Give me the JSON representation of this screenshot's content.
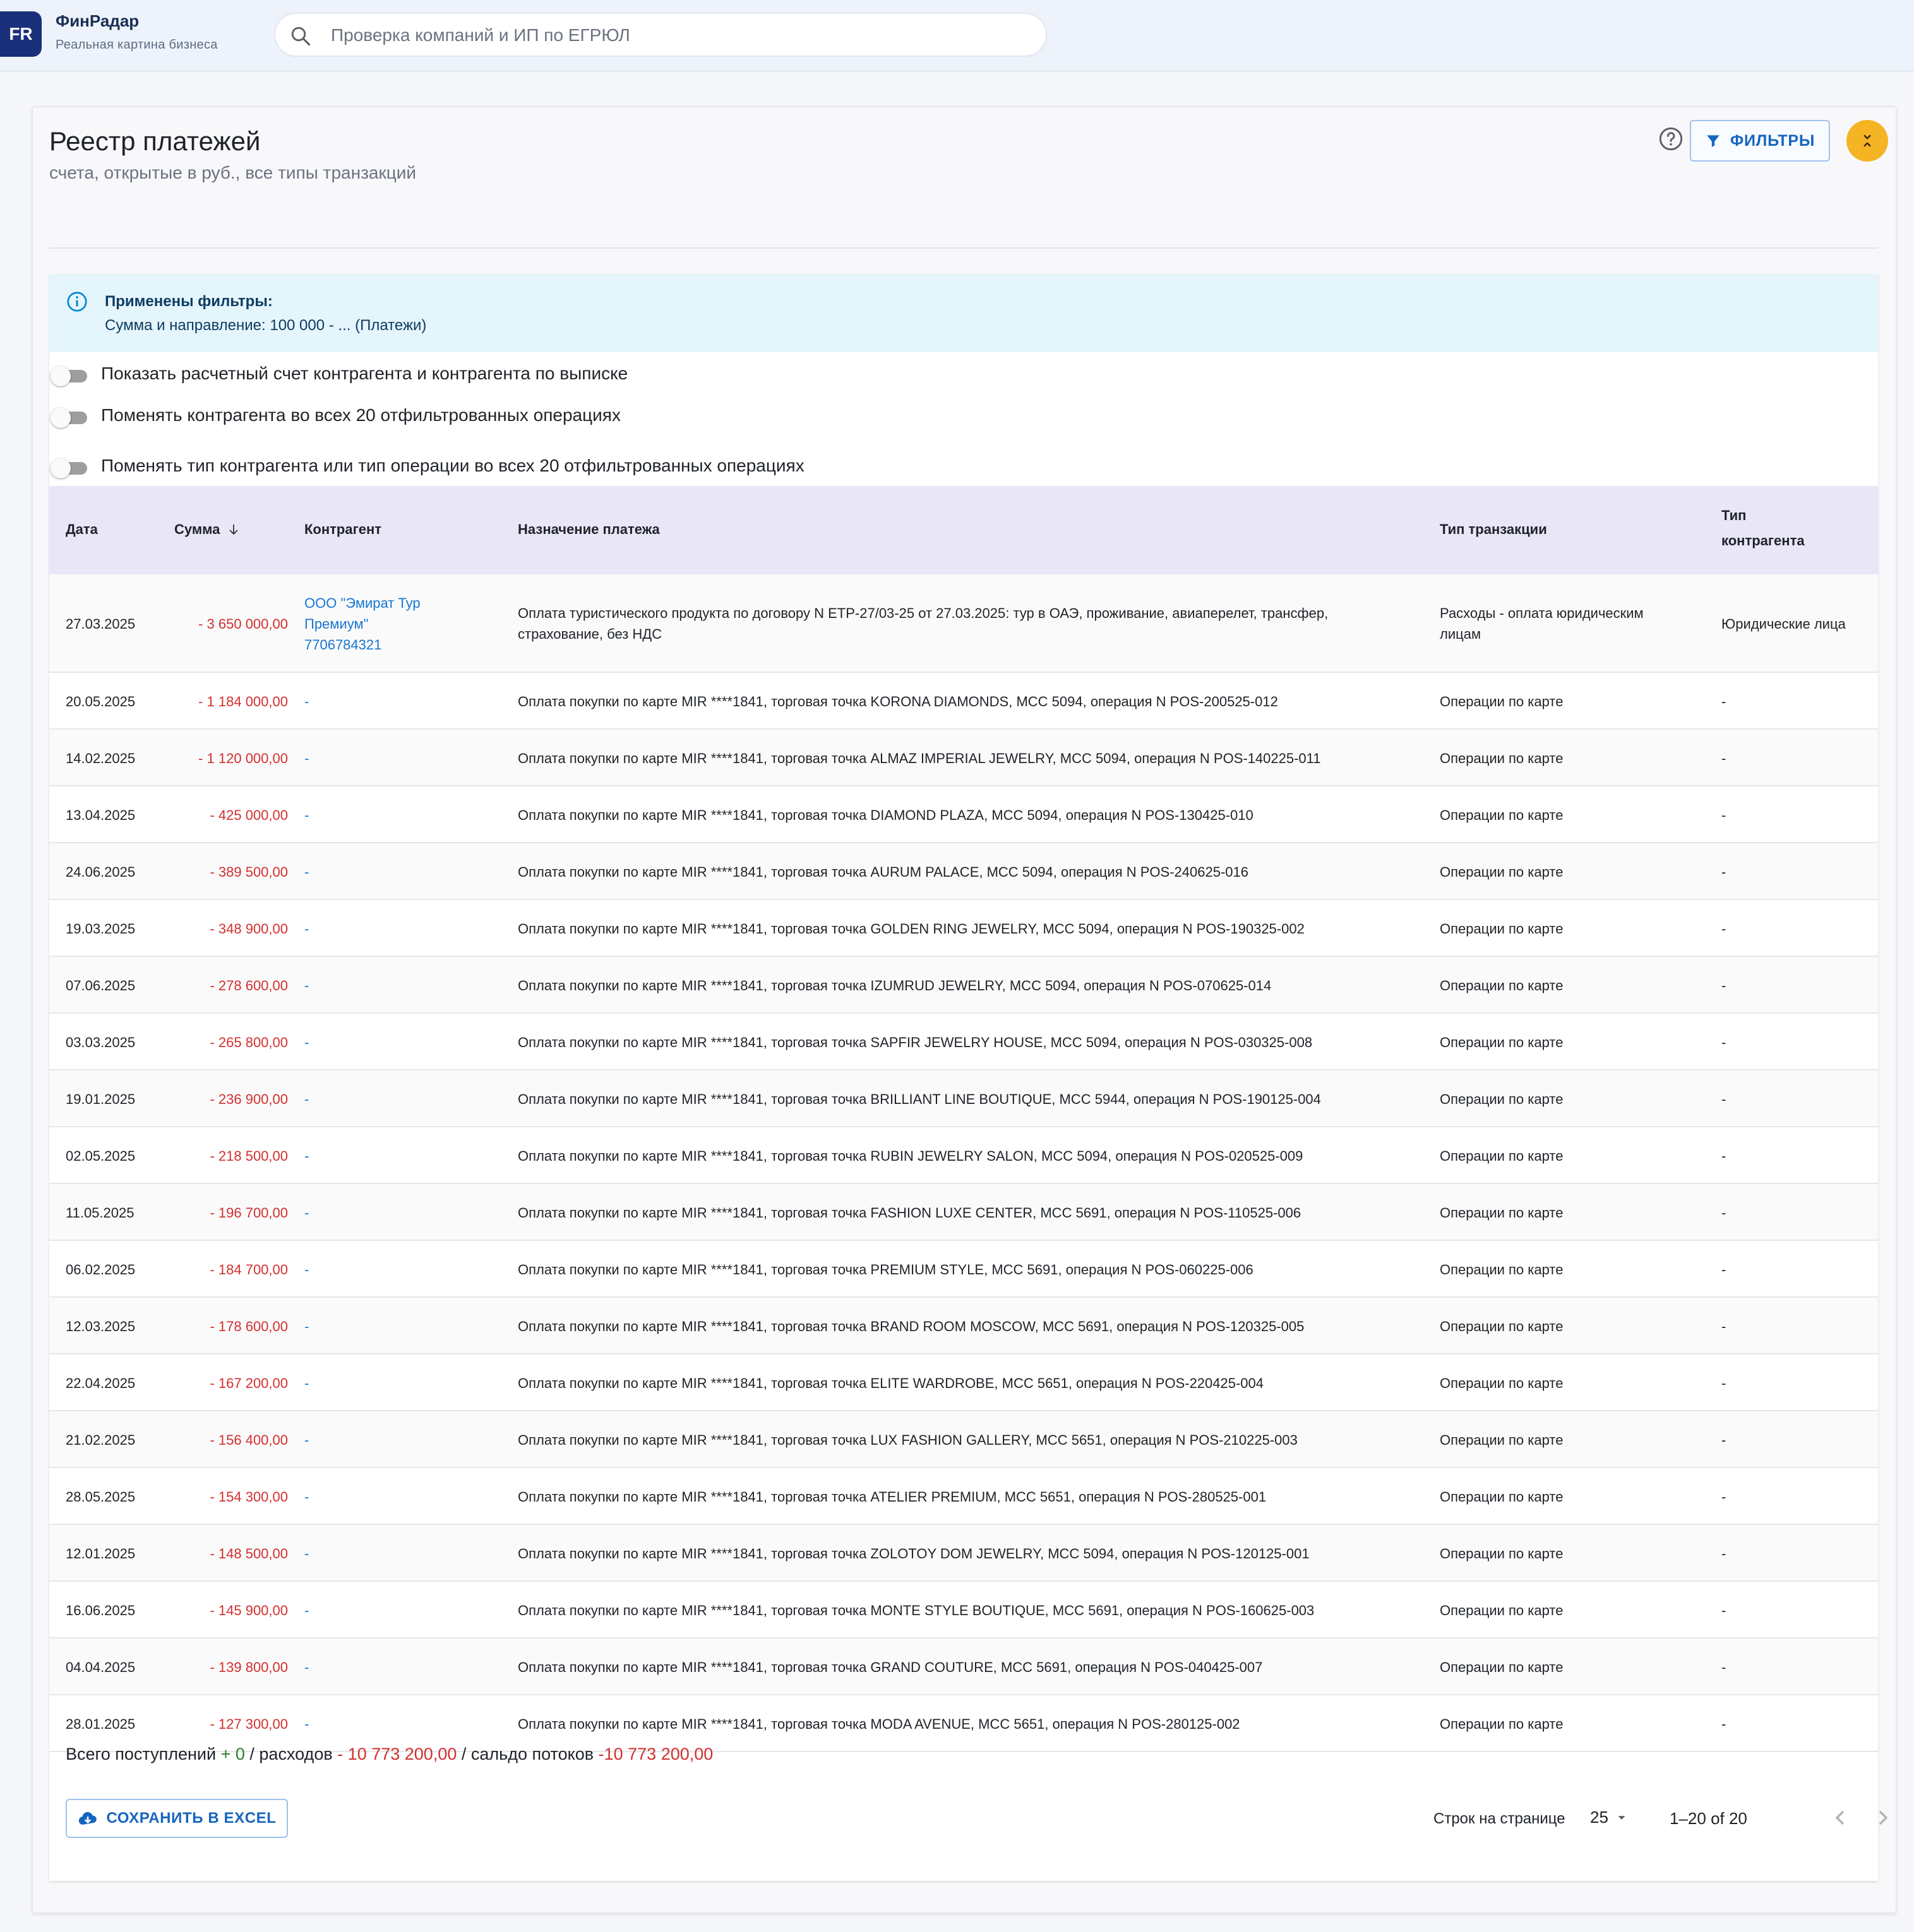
{
  "app": {
    "logo": "FR",
    "name": "ФинРадар",
    "tagline": "Реальная картина бизнеса",
    "search_placeholder": "Проверка компаний и ИП по ЕГРЮЛ"
  },
  "page": {
    "title": "Реестр платежей",
    "subtitle": "счета, открытые в руб., все типы транзакций",
    "filters_label": "ФИЛЬТРЫ"
  },
  "alert": {
    "title": "Применены фильтры:",
    "text": "Сумма и направление: 100 000 - ... (Платежи)"
  },
  "toggles": [
    {
      "label": "Показать расчетный счет контрагента и контрагента по выписке",
      "checked": false
    },
    {
      "label": "Поменять контрагента во всех 20 отфильтрованных операциях",
      "checked": false
    },
    {
      "label": "Поменять тип контрагента или тип операции во всех 20 отфильтрованных операциях",
      "checked": false
    }
  ],
  "table": {
    "headers": {
      "date": "Дата",
      "amount": "Сумма",
      "counterparty": "Контрагент",
      "purpose": "Назначение платежа",
      "tx_type": "Тип транзакции",
      "cp_type_1": "Тип",
      "cp_type_2": "контрагента"
    },
    "sort": {
      "column": "amount",
      "direction": "desc"
    },
    "rows": [
      {
        "date": "27.03.2025",
        "amount": "- 3 650 000,00",
        "counterparty": [
          "ООО \"Эмират Тур",
          "Премиум\"",
          "7706784321"
        ],
        "purpose": [
          "Оплата туристического продукта по договору N ETP-27/03-25 от 27.03.2025: тур в ОАЭ, проживание, авиаперелет, трансфер,",
          "страхование, без НДС"
        ],
        "tx_type": [
          "Расходы - оплата юридическим",
          "лицам"
        ],
        "cp_type": "Юридические лица"
      },
      {
        "date": "20.05.2025",
        "amount": "- 1 184 000,00",
        "counterparty": [
          "-"
        ],
        "purpose": [
          "Оплата покупки по карте MIR ****1841, торговая точка KORONA DIAMONDS, MCC 5094, операция N POS-200525-012"
        ],
        "tx_type": [
          "Операции по карте"
        ],
        "cp_type": "-"
      },
      {
        "date": "14.02.2025",
        "amount": "- 1 120 000,00",
        "counterparty": [
          "-"
        ],
        "purpose": [
          "Оплата покупки по карте MIR ****1841, торговая точка ALMAZ IMPERIAL JEWELRY, MCC 5094, операция N POS-140225-011"
        ],
        "tx_type": [
          "Операции по карте"
        ],
        "cp_type": "-"
      },
      {
        "date": "13.04.2025",
        "amount": "- 425 000,00",
        "counterparty": [
          "-"
        ],
        "purpose": [
          "Оплата покупки по карте MIR ****1841, торговая точка DIAMOND PLAZA, MCC 5094, операция N POS-130425-010"
        ],
        "tx_type": [
          "Операции по карте"
        ],
        "cp_type": "-"
      },
      {
        "date": "24.06.2025",
        "amount": "- 389 500,00",
        "counterparty": [
          "-"
        ],
        "purpose": [
          "Оплата покупки по карте MIR ****1841, торговая точка AURUM PALACE, MCC 5094, операция N POS-240625-016"
        ],
        "tx_type": [
          "Операции по карте"
        ],
        "cp_type": "-"
      },
      {
        "date": "19.03.2025",
        "amount": "- 348 900,00",
        "counterparty": [
          "-"
        ],
        "purpose": [
          "Оплата покупки по карте MIR ****1841, торговая точка GOLDEN RING JEWELRY, MCC 5094, операция N POS-190325-002"
        ],
        "tx_type": [
          "Операции по карте"
        ],
        "cp_type": "-"
      },
      {
        "date": "07.06.2025",
        "amount": "- 278 600,00",
        "counterparty": [
          "-"
        ],
        "purpose": [
          "Оплата покупки по карте MIR ****1841, торговая точка IZUMRUD JEWELRY, MCC 5094, операция N POS-070625-014"
        ],
        "tx_type": [
          "Операции по карте"
        ],
        "cp_type": "-"
      },
      {
        "date": "03.03.2025",
        "amount": "- 265 800,00",
        "counterparty": [
          "-"
        ],
        "purpose": [
          "Оплата покупки по карте MIR ****1841, торговая точка SAPFIR JEWELRY HOUSE, MCC 5094, операция N POS-030325-008"
        ],
        "tx_type": [
          "Операции по карте"
        ],
        "cp_type": "-"
      },
      {
        "date": "19.01.2025",
        "amount": "- 236 900,00",
        "counterparty": [
          "-"
        ],
        "purpose": [
          "Оплата покупки по карте MIR ****1841, торговая точка BRILLIANT LINE BOUTIQUE, MCC 5944, операция N POS-190125-004"
        ],
        "tx_type": [
          "Операции по карте"
        ],
        "cp_type": "-"
      },
      {
        "date": "02.05.2025",
        "amount": "- 218 500,00",
        "counterparty": [
          "-"
        ],
        "purpose": [
          "Оплата покупки по карте MIR ****1841, торговая точка RUBIN JEWELRY SALON, MCC 5094, операция N POS-020525-009"
        ],
        "tx_type": [
          "Операции по карте"
        ],
        "cp_type": "-"
      },
      {
        "date": "11.05.2025",
        "amount": "- 196 700,00",
        "counterparty": [
          "-"
        ],
        "purpose": [
          "Оплата покупки по карте MIR ****1841, торговая точка FASHION LUXE CENTER, MCC 5691, операция N POS-110525-006"
        ],
        "tx_type": [
          "Операции по карте"
        ],
        "cp_type": "-"
      },
      {
        "date": "06.02.2025",
        "amount": "- 184 700,00",
        "counterparty": [
          "-"
        ],
        "purpose": [
          "Оплата покупки по карте MIR ****1841, торговая точка PREMIUM STYLE, MCC 5691, операция N POS-060225-006"
        ],
        "tx_type": [
          "Операции по карте"
        ],
        "cp_type": "-"
      },
      {
        "date": "12.03.2025",
        "amount": "- 178 600,00",
        "counterparty": [
          "-"
        ],
        "purpose": [
          "Оплата покупки по карте MIR ****1841, торговая точка BRAND ROOM MOSCOW, MCC 5691, операция N POS-120325-005"
        ],
        "tx_type": [
          "Операции по карте"
        ],
        "cp_type": "-"
      },
      {
        "date": "22.04.2025",
        "amount": "- 167 200,00",
        "counterparty": [
          "-"
        ],
        "purpose": [
          "Оплата покупки по карте MIR ****1841, торговая точка ELITE WARDROBE, MCC 5651, операция N POS-220425-004"
        ],
        "tx_type": [
          "Операции по карте"
        ],
        "cp_type": "-"
      },
      {
        "date": "21.02.2025",
        "amount": "- 156 400,00",
        "counterparty": [
          "-"
        ],
        "purpose": [
          "Оплата покупки по карте MIR ****1841, торговая точка LUX FASHION GALLERY, MCC 5651, операция N POS-210225-003"
        ],
        "tx_type": [
          "Операции по карте"
        ],
        "cp_type": "-"
      },
      {
        "date": "28.05.2025",
        "amount": "- 154 300,00",
        "counterparty": [
          "-"
        ],
        "purpose": [
          "Оплата покупки по карте MIR ****1841, торговая точка ATELIER PREMIUM, MCC 5651, операция N POS-280525-001"
        ],
        "tx_type": [
          "Операции по карте"
        ],
        "cp_type": "-"
      },
      {
        "date": "12.01.2025",
        "amount": "- 148 500,00",
        "counterparty": [
          "-"
        ],
        "purpose": [
          "Оплата покупки по карте MIR ****1841, торговая точка ZOLOTOY DOM JEWELRY, MCC 5094, операция N POS-120125-001"
        ],
        "tx_type": [
          "Операции по карте"
        ],
        "cp_type": "-"
      },
      {
        "date": "16.06.2025",
        "amount": "- 145 900,00",
        "counterparty": [
          "-"
        ],
        "purpose": [
          "Оплата покупки по карте MIR ****1841, торговая точка MONTE STYLE BOUTIQUE, MCC 5691, операция N POS-160625-003"
        ],
        "tx_type": [
          "Операции по карте"
        ],
        "cp_type": "-"
      },
      {
        "date": "04.04.2025",
        "amount": "- 139 800,00",
        "counterparty": [
          "-"
        ],
        "purpose": [
          "Оплата покупки по карте MIR ****1841, торговая точка GRAND COUTURE, MCC 5691, операция N POS-040425-007"
        ],
        "tx_type": [
          "Операции по карте"
        ],
        "cp_type": "-"
      },
      {
        "date": "28.01.2025",
        "amount": "- 127 300,00",
        "counterparty": [
          "-"
        ],
        "purpose": [
          "Оплата покупки по карте MIR ****1841, торговая точка MODA AVENUE, MCC 5651, операция N POS-280125-002"
        ],
        "tx_type": [
          "Операции по карте"
        ],
        "cp_type": "-"
      }
    ]
  },
  "summary": {
    "income_label": "Всего поступлений",
    "income_value": "+ 0",
    "expense_label": "/ расходов",
    "expense_value": "- 10 773 200,00",
    "balance_label": "/ сальдо потоков",
    "balance_value": "-10 773 200,00"
  },
  "footer": {
    "excel_label": "СОХРАНИТЬ В EXCEL",
    "rows_per_page_label": "Строк на странице",
    "rows_per_page_value": "25",
    "range": "1–20 of 20"
  },
  "colors": {
    "brand": "#1a2f7a",
    "accent": "#1565c0",
    "negative": "#d32f2f",
    "positive": "#2e7d32",
    "header_bg": "#e8e6f7",
    "alert_bg": "#e5f5fc",
    "collapse_btn": "#f4b423"
  },
  "icons": {
    "search": "search-icon",
    "help": "help-circle-icon",
    "filter": "filter-icon",
    "collapse": "collapse-icon",
    "info": "info-icon",
    "sort": "arrow-down-icon",
    "cloud": "cloud-download-icon",
    "dropdown": "caret-down-icon",
    "prev": "chevron-left-icon",
    "next": "chevron-right-icon"
  }
}
